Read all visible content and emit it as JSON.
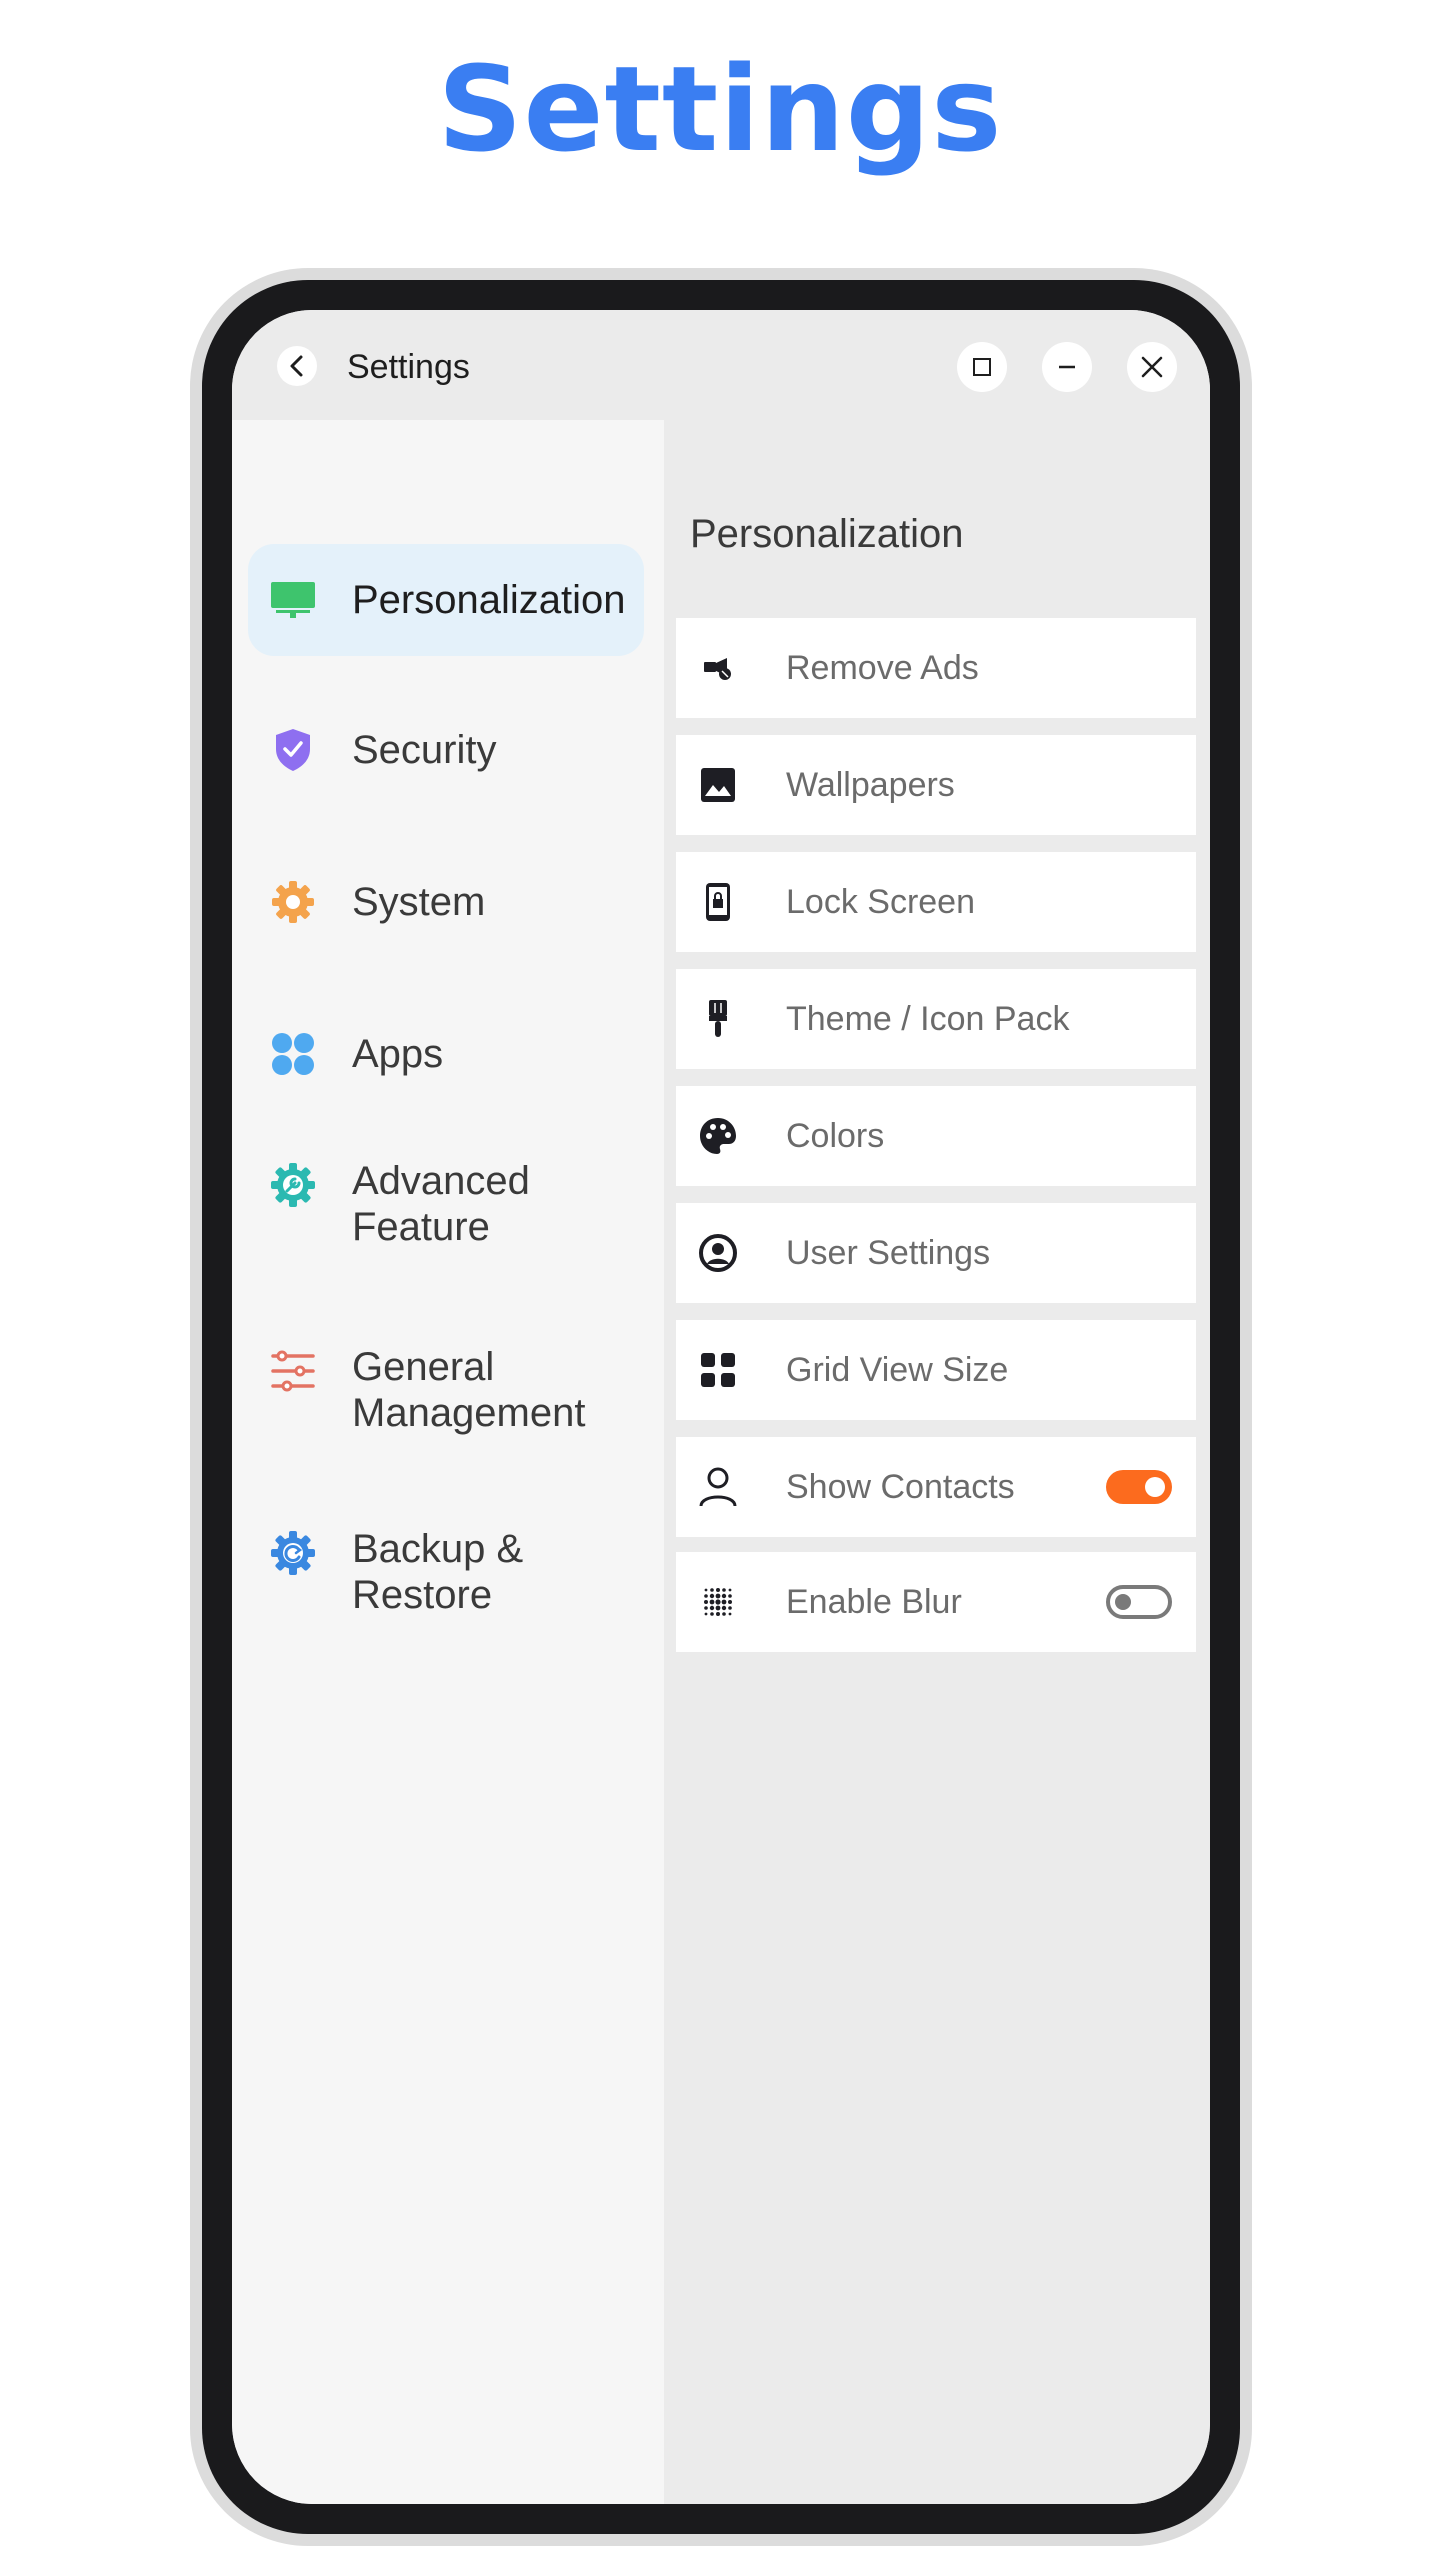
{
  "page": {
    "title": "Settings",
    "title_color": "#3a7ef2"
  },
  "window": {
    "title": "Settings"
  },
  "sidebar": {
    "items": [
      {
        "label": "Personalization",
        "icon": "monitor-icon",
        "color": "#3ec46d",
        "active": true
      },
      {
        "label": "Security",
        "icon": "shield-icon",
        "color": "#8e6ff0",
        "active": false
      },
      {
        "label": "System",
        "icon": "gear-icon",
        "color": "#f4a34c",
        "active": false
      },
      {
        "label": "Apps",
        "icon": "apps-grid-icon",
        "color": "#4fa9f0",
        "active": false
      },
      {
        "label": "Advanced\nFeature",
        "icon": "wrench-gear-icon",
        "color": "#2bb9b1",
        "active": false
      },
      {
        "label": "General\nManagement",
        "icon": "sliders-icon",
        "color": "#e37363",
        "active": false
      },
      {
        "label": "Backup &\nRestore",
        "icon": "backup-gear-icon",
        "color": "#3a88e0",
        "active": false
      }
    ]
  },
  "content": {
    "title": "Personalization",
    "rows": [
      {
        "label": "Remove Ads",
        "icon": "ads-icon"
      },
      {
        "label": "Wallpapers",
        "icon": "image-icon"
      },
      {
        "label": "Lock Screen",
        "icon": "lock-phone-icon"
      },
      {
        "label": "Theme / Icon Pack",
        "icon": "paintbrush-icon"
      },
      {
        "label": "Colors",
        "icon": "palette-icon"
      },
      {
        "label": "User Settings",
        "icon": "user-circle-icon"
      },
      {
        "label": "Grid View Size",
        "icon": "grid-icon"
      },
      {
        "label": "Show Contacts",
        "icon": "person-icon",
        "toggle": true
      },
      {
        "label": "Enable Blur",
        "icon": "blur-icon",
        "toggle": false
      }
    ]
  }
}
